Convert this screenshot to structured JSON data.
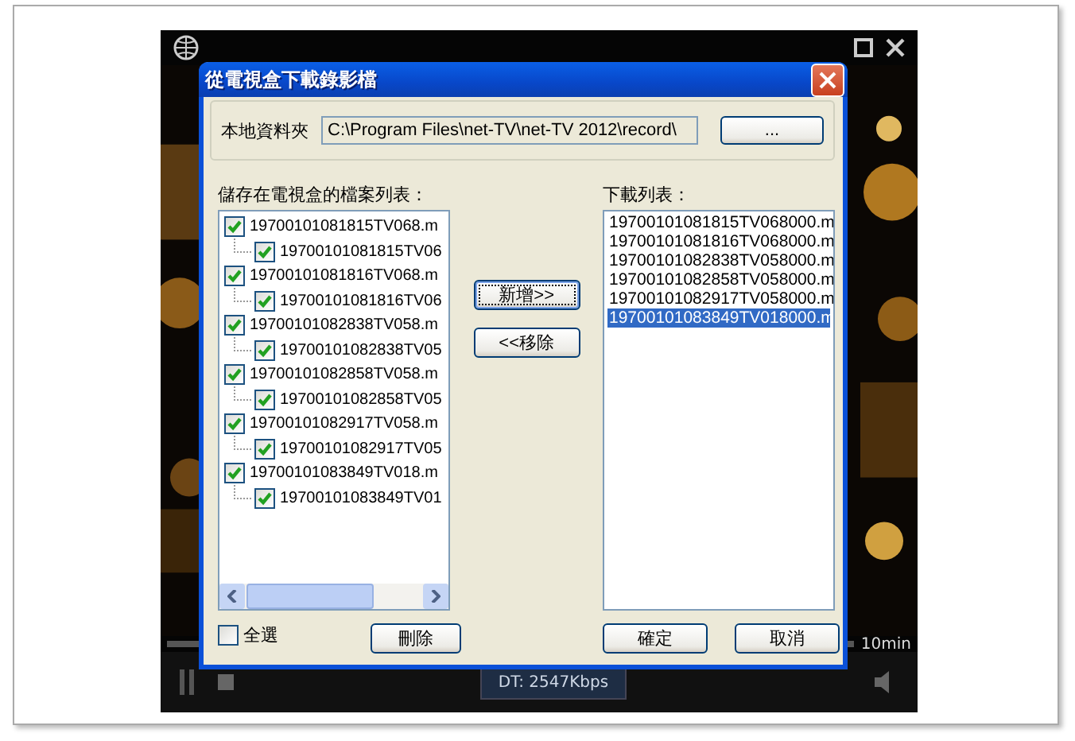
{
  "player": {
    "speed": "DT: 2547Kbps",
    "duration": "10min"
  },
  "window": {
    "title": "從電視盒下載錄影檔"
  },
  "folder": {
    "label": "本地資料夾",
    "value": "C:\\Program Files\\net-TV\\net-TV 2012\\record\\",
    "browse_button": "..."
  },
  "device_files": {
    "label": "儲存在電視盒的檔案列表：",
    "items": [
      {
        "label": "19700101081815TV068.m",
        "checked": true,
        "children": [
          {
            "label": "19700101081815TV06",
            "checked": true
          }
        ]
      },
      {
        "label": "19700101081816TV068.m",
        "checked": true,
        "children": [
          {
            "label": "19700101081816TV06",
            "checked": true
          }
        ]
      },
      {
        "label": "19700101082838TV058.m",
        "checked": true,
        "children": [
          {
            "label": "19700101082838TV05",
            "checked": true
          }
        ]
      },
      {
        "label": "19700101082858TV058.m",
        "checked": true,
        "children": [
          {
            "label": "19700101082858TV05",
            "checked": true
          }
        ]
      },
      {
        "label": "19700101082917TV058.m",
        "checked": true,
        "children": [
          {
            "label": "19700101082917TV05",
            "checked": true
          }
        ]
      },
      {
        "label": "19700101083849TV018.m",
        "checked": true,
        "children": [
          {
            "label": "19700101083849TV01",
            "checked": true
          }
        ]
      }
    ]
  },
  "move_buttons": [
    {
      "label": "新增>>",
      "focused": true
    },
    {
      "label": "<<移除",
      "focused": false
    }
  ],
  "download_list": {
    "label": "下載列表：",
    "items": [
      {
        "label": "19700101081815TV068000.m",
        "selected": false
      },
      {
        "label": "19700101081816TV068000.m",
        "selected": false
      },
      {
        "label": "19700101082838TV058000.m",
        "selected": false
      },
      {
        "label": "19700101082858TV058000.m",
        "selected": false
      },
      {
        "label": "19700101082917TV058000.m",
        "selected": false
      },
      {
        "label": "19700101083849TV018000.m",
        "selected": true
      }
    ]
  },
  "select_all": {
    "label": "全選",
    "checked": false
  },
  "delete_button": "刪除",
  "buttons": [
    "確定",
    "取消"
  ]
}
